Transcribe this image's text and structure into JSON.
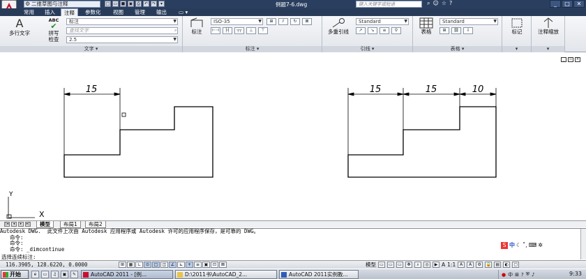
{
  "titlebar": {
    "workspace": "二维草图与注释",
    "doc_title": "例题7-6.dwg",
    "help_placeholder": "键入关键字或短语",
    "window_buttons": [
      "_",
      "□",
      "✕"
    ]
  },
  "tabs": [
    "常用",
    "插入",
    "注释",
    "参数化",
    "视图",
    "管理",
    "输出"
  ],
  "ribbon": {
    "text_panel": {
      "mtext": "多行文字",
      "spell_top": "ABC",
      "spell": "拼写\n检查",
      "style_value": "标注",
      "find_placeholder": "查找文字",
      "height_value": "2.5",
      "title": "文字"
    },
    "dim_panel": {
      "dimension": "标注",
      "dimstyle_value": "ISO-35",
      "title": "标注"
    },
    "leader_panel": {
      "multileader": "多重引线",
      "mleader_style": "Standard",
      "title": "引线"
    },
    "table_panel": {
      "table": "表格",
      "table_style": "Standard",
      "title": "表格"
    },
    "markup_panel": {
      "label": "标记"
    },
    "scale_panel": {
      "label": "注释缩放"
    }
  },
  "drawing": {
    "left_dims": [
      "15"
    ],
    "right_dims": [
      "15",
      "15",
      "10"
    ],
    "ucs": {
      "x": "X",
      "y": "Y"
    }
  },
  "layout_tabs": [
    "模型",
    "布局1",
    "布局2"
  ],
  "command": {
    "lines": [
      "Autodesk DWG.  此文件上次由 Autodesk 应用程序或 Autodesk 许可的应用程序保存，是可靠的 DWG。",
      "命令:",
      "命令:",
      "命令: _dimcontinue"
    ],
    "prompt": "选择连续标注:"
  },
  "ime": {
    "label": "中"
  },
  "status": {
    "coords": "116.3905, 128.6220, 0.0000",
    "model": "模型",
    "scale": "1:1"
  },
  "taskbar": {
    "start": "开始",
    "buttons": [
      "AutoCAD 2011 - [例...",
      "D:\\2011书\\AutoCAD_2...",
      "AutoCAD 2011实例教..."
    ],
    "clock": "9:33"
  }
}
